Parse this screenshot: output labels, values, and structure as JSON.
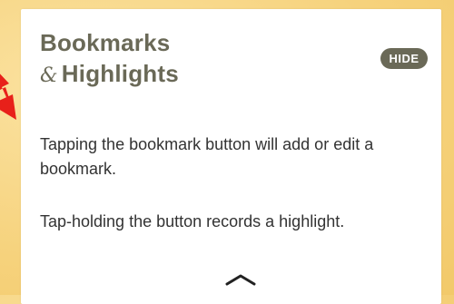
{
  "panel": {
    "title_line1": "Bookmarks",
    "title_amp": "&",
    "title_line2": "Highlights",
    "hide_label": "HIDE",
    "paragraph1": "Tapping the bookmark button will add or edit a bookmark.",
    "paragraph2": "Tap-holding the button records a highlight."
  },
  "icons": {
    "pointer": "red-arrow-icon",
    "collapse": "chevron-up-icon"
  },
  "colors": {
    "background": "#f8d98b",
    "panel": "#ffffff",
    "title": "#6a6957",
    "hide_button_bg": "#6a6957",
    "arrow": "#e8201a",
    "body_text": "#333333"
  }
}
